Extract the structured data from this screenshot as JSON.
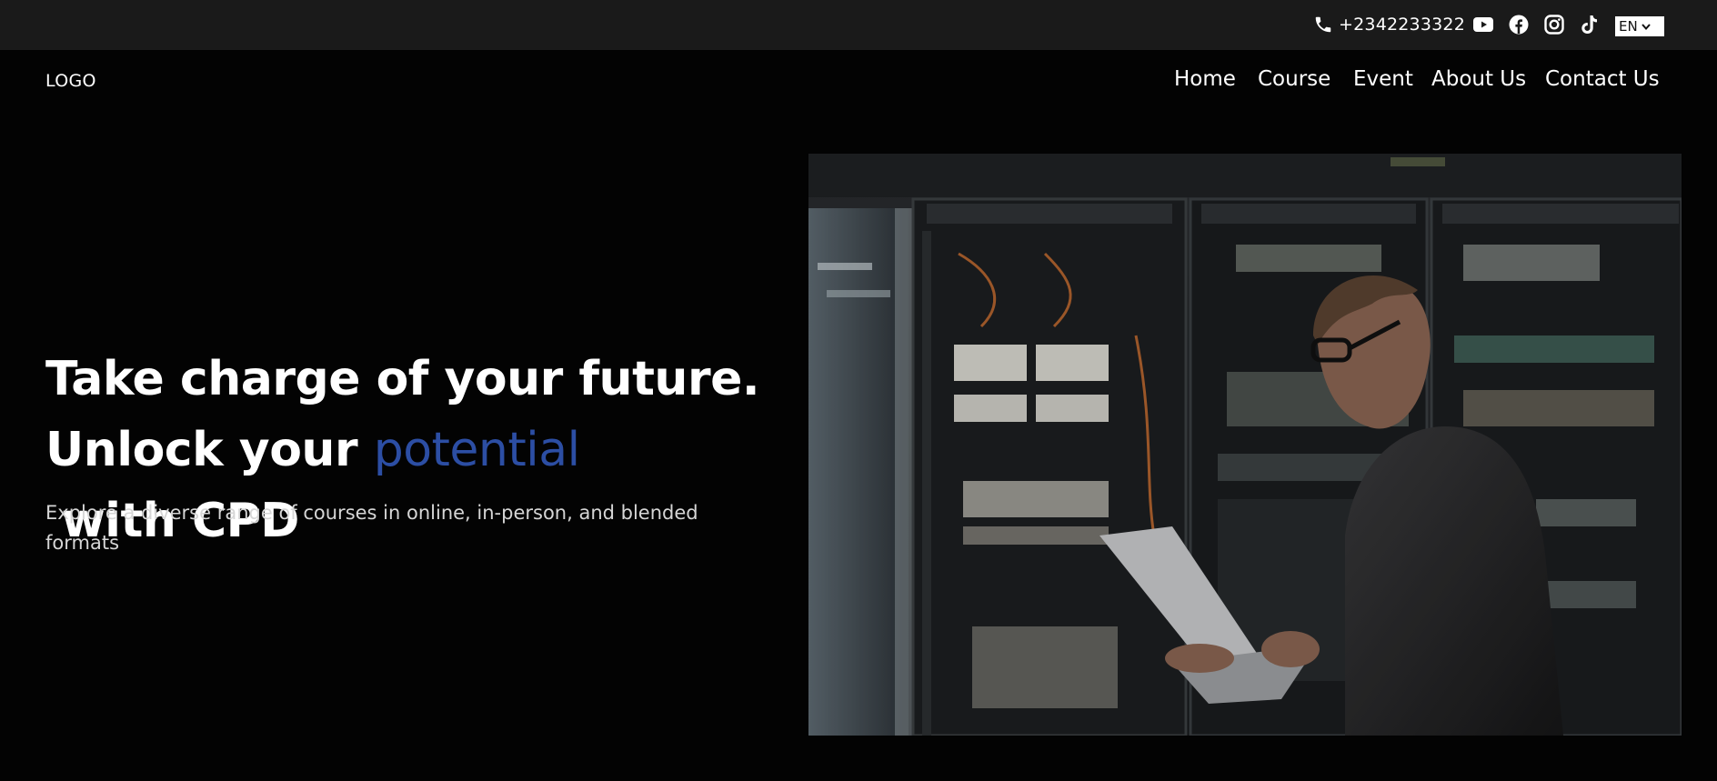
{
  "topbar": {
    "phone_number": "+2342233322",
    "icons": {
      "phone": "phone-icon",
      "youtube": "youtube-icon",
      "facebook": "facebook-icon",
      "instagram": "instagram-icon",
      "tiktok": "tiktok-icon"
    },
    "language": "EN"
  },
  "header": {
    "logo": "LOGO",
    "nav": [
      "Home",
      "Course",
      "Event",
      "About Us",
      "Contact Us"
    ]
  },
  "hero": {
    "headline_line1": "Take charge of your future.",
    "headline_line2_start": "Unlock your ",
    "headline_line2_accent": "potential",
    "headline_line2_end": " with CPD",
    "subtext": "Explore a diverse range of courses in online, in-person, and blended formats",
    "image_alt": "Technician with laptop in server room",
    "accent_color": "#2c4ea4"
  }
}
